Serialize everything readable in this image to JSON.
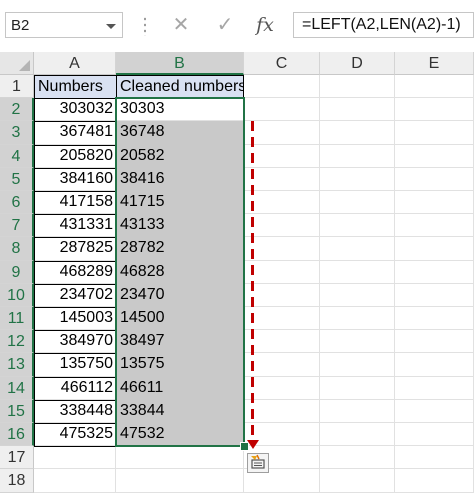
{
  "namebox": {
    "value": "B2"
  },
  "formula_bar": {
    "cancel_icon": "✕",
    "enter_icon": "✓",
    "fx_label": "fx",
    "formula": "=LEFT(A2,LEN(A2)-1)"
  },
  "columns": [
    "A",
    "B",
    "C",
    "D",
    "E"
  ],
  "rows": [
    "1",
    "2",
    "3",
    "4",
    "5",
    "6",
    "7",
    "8",
    "9",
    "10",
    "11",
    "12",
    "13",
    "14",
    "15",
    "16",
    "17",
    "18"
  ],
  "headers": {
    "A": "Numbers",
    "B": "Cleaned numbers"
  },
  "data": [
    {
      "a": "303032",
      "b": "30303"
    },
    {
      "a": "367481",
      "b": "36748"
    },
    {
      "a": "205820",
      "b": "20582"
    },
    {
      "a": "384160",
      "b": "38416"
    },
    {
      "a": "417158",
      "b": "41715"
    },
    {
      "a": "431331",
      "b": "43133"
    },
    {
      "a": "287825",
      "b": "28782"
    },
    {
      "a": "468289",
      "b": "46828"
    },
    {
      "a": "234702",
      "b": "23470"
    },
    {
      "a": "145003",
      "b": "14500"
    },
    {
      "a": "384970",
      "b": "38497"
    },
    {
      "a": "135750",
      "b": "13575"
    },
    {
      "a": "466112",
      "b": "46611"
    },
    {
      "a": "338448",
      "b": "33844"
    },
    {
      "a": "475325",
      "b": "47532"
    }
  ],
  "colors": {
    "selection": "#217346",
    "header_fill": "#d9e1f2",
    "fill_shade": "#c9c9c9",
    "arrow": "#c00000"
  },
  "icons": {
    "autofill": "autofill-options-icon"
  }
}
